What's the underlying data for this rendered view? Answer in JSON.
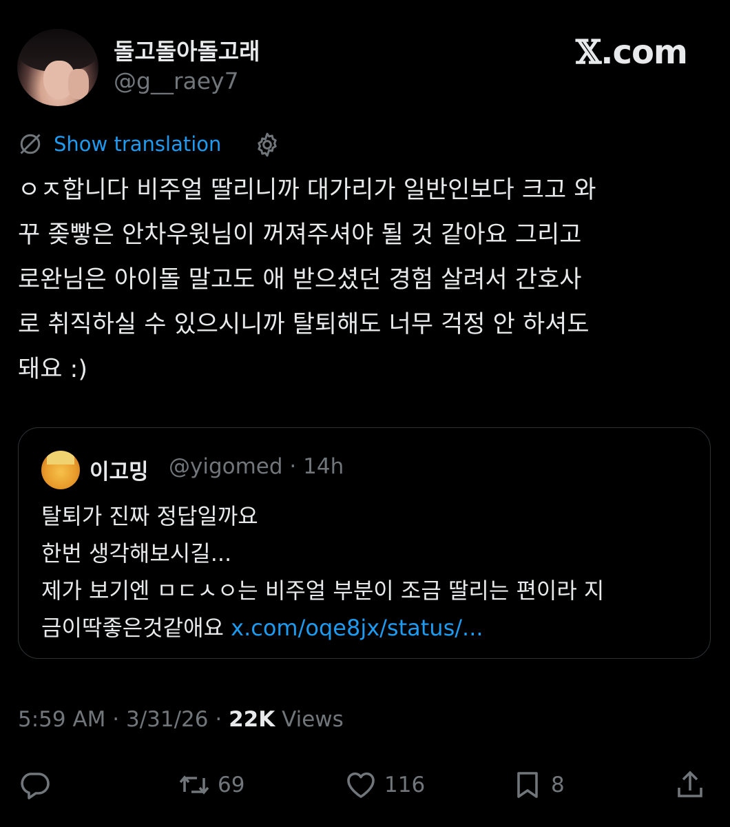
{
  "author": {
    "display_name": "돌고돌아돌고래",
    "handle": "@g__raey7"
  },
  "brand": {
    "x_mark": "𝕏",
    "suffix": ".com"
  },
  "translation": {
    "label": "Show translation",
    "icon": "translate-icon",
    "settings_icon": "gear-icon"
  },
  "tweet": {
    "lines": [
      "ㅇㅈ합니다 비주얼 딸리니까 대가리가 일반인보다 크고 와",
      "꾸 좆빻은 안차우윗님이 꺼져주셔야 될 것 같아요 그리고",
      "로완님은 아이돌 말고도 애 받으셨던 경험 살려서 간호사",
      "로 취직하실 수 있으시니까 탈퇴해도 너무 걱정 안 하셔도",
      "돼요 :)"
    ]
  },
  "quote": {
    "display_name": "이고밍",
    "handle": "@yigomed",
    "separator": "·",
    "time": "14h",
    "lines": [
      "탈퇴가 진짜 정답일까요",
      "한번 생각해보시길...",
      "제가 보기엔 ㅁㄷㅅㅇ는 비주얼 부분이 조금 딸리는 편이라 지"
    ],
    "last_line_text": "금이딱좋은것같애요 ",
    "link": "x.com/oqe8jx/status/..."
  },
  "meta": {
    "time": "5:59 AM",
    "separator1": " · ",
    "date": "3/31/26",
    "separator2": " · ",
    "views_count": "22K",
    "views_label": " Views"
  },
  "actions": {
    "reply": {
      "icon": "reply-icon",
      "count": ""
    },
    "retweet": {
      "icon": "retweet-icon",
      "count": "69"
    },
    "like": {
      "icon": "heart-icon",
      "count": "116"
    },
    "bookmark": {
      "icon": "bookmark-icon",
      "count": "8"
    },
    "share": {
      "icon": "share-icon",
      "count": ""
    }
  },
  "colors": {
    "background": "#000000",
    "text": "#e7e9ea",
    "secondary": "#71767b",
    "link": "#1d9bf0",
    "border": "#2f3336"
  }
}
